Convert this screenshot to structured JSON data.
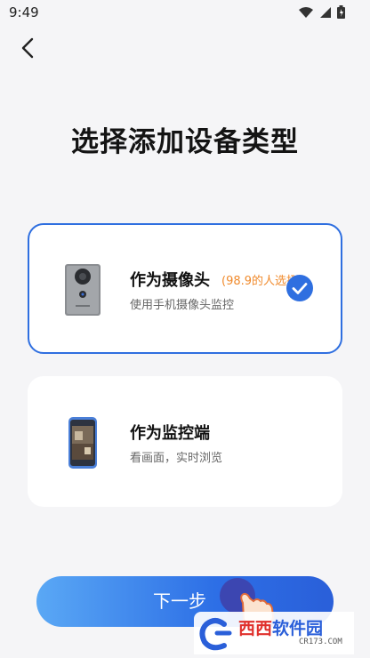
{
  "status": {
    "time": "9:49"
  },
  "page": {
    "title": "选择添加设备类型"
  },
  "options": [
    {
      "name": "作为摄像头",
      "hint": "(98.9的人选择)",
      "desc": "使用手机摄像头监控",
      "selected": true
    },
    {
      "name": "作为监控端",
      "desc": "看画面，实时浏览",
      "selected": false
    }
  ],
  "next_button": {
    "label": "下一步"
  },
  "watermark": {
    "brand_red": "西西",
    "brand_blue": "软件园",
    "url": "CR173.COM"
  },
  "colors": {
    "accent": "#2f6fe0",
    "hint": "#f08a2c",
    "background": "#f5f5f7"
  },
  "icons": [
    "back-chevron-icon",
    "wifi-icon",
    "signal-icon",
    "battery-icon",
    "check-circle-icon",
    "camera-device-icon",
    "phone-monitor-icon",
    "hand-pointer-icon"
  ]
}
